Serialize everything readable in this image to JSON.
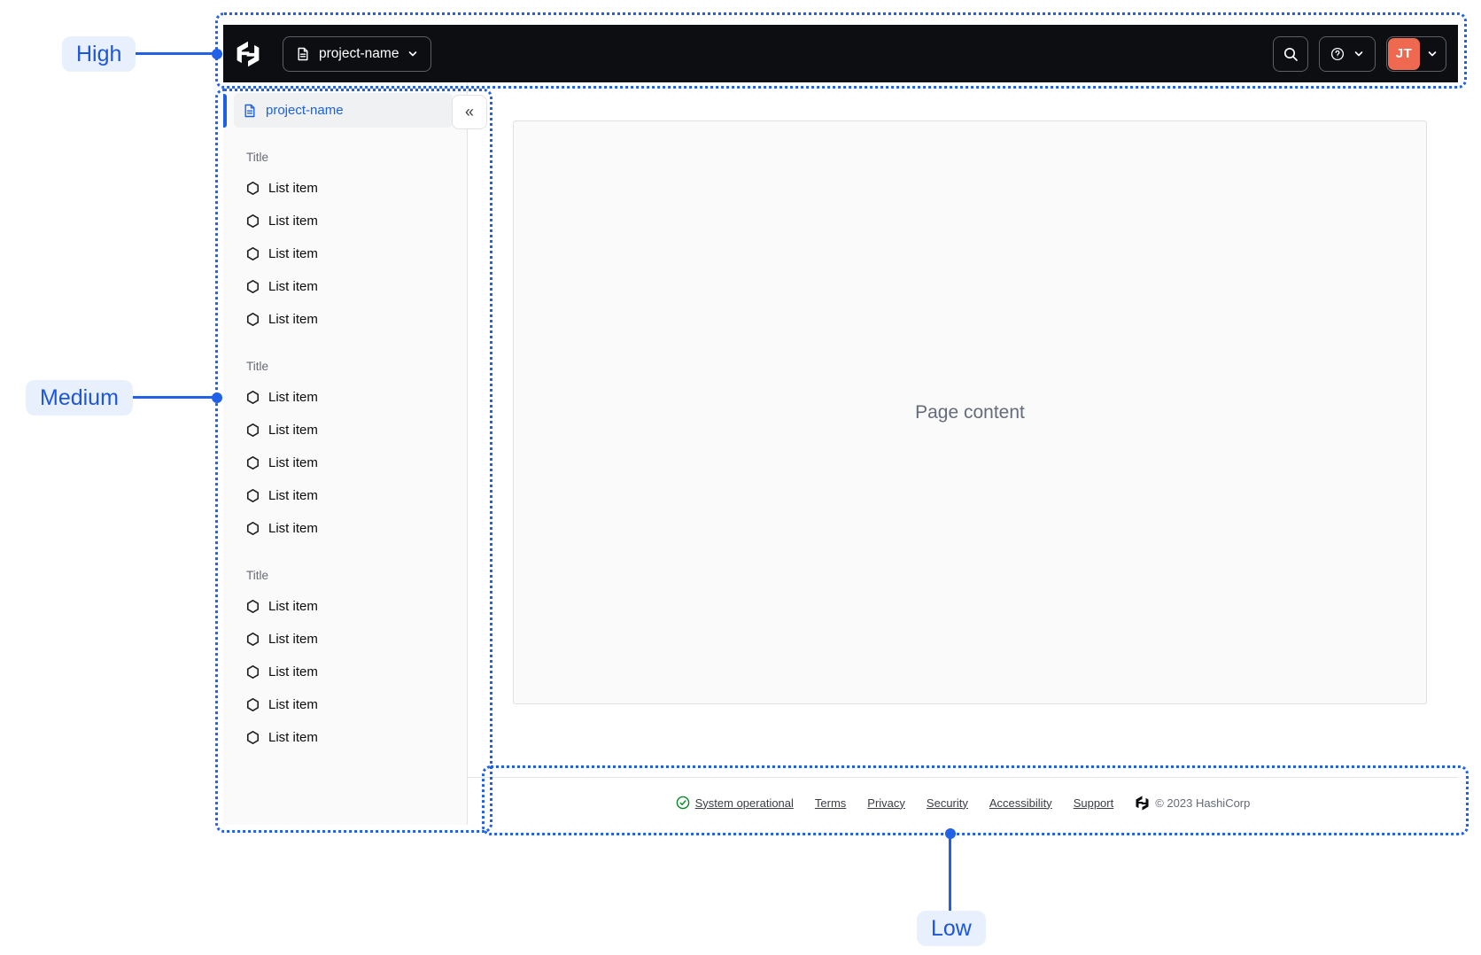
{
  "annotations": {
    "high": "High",
    "medium": "Medium",
    "low": "Low"
  },
  "navbar": {
    "project_name": "project-name",
    "user_initials": "JT"
  },
  "sidebar": {
    "active_item": "project-name",
    "collapse_glyph": "«",
    "sections": [
      {
        "title": "Title",
        "items": [
          "List item",
          "List item",
          "List item",
          "List item",
          "List item"
        ]
      },
      {
        "title": "Title",
        "items": [
          "List item",
          "List item",
          "List item",
          "List item",
          "List item"
        ]
      },
      {
        "title": "Title",
        "items": [
          "List item",
          "List item",
          "List item",
          "List item",
          "List item"
        ]
      }
    ]
  },
  "main": {
    "placeholder": "Page content"
  },
  "footer": {
    "status": "System operational",
    "links": [
      "Terms",
      "Privacy",
      "Security",
      "Accessibility",
      "Support"
    ],
    "copyright": "© 2023 HashiCorp"
  },
  "icons": {
    "brand": "hashicorp-logo",
    "project": "document-icon",
    "search": "search-icon",
    "help": "help-icon",
    "dropdown": "chevron-down-icon",
    "collapse": "double-chevron-left-icon",
    "list_bullet": "hexagon-icon",
    "status": "check-circle-icon"
  },
  "colors": {
    "annotation_blue": "#2161E8",
    "annotation_pill_bg": "#E8F0FE",
    "navbar_bg": "#0D0E12",
    "avatar_bg": "#EF6950",
    "active_blue": "#1C61E3",
    "status_green": "#008A22"
  }
}
